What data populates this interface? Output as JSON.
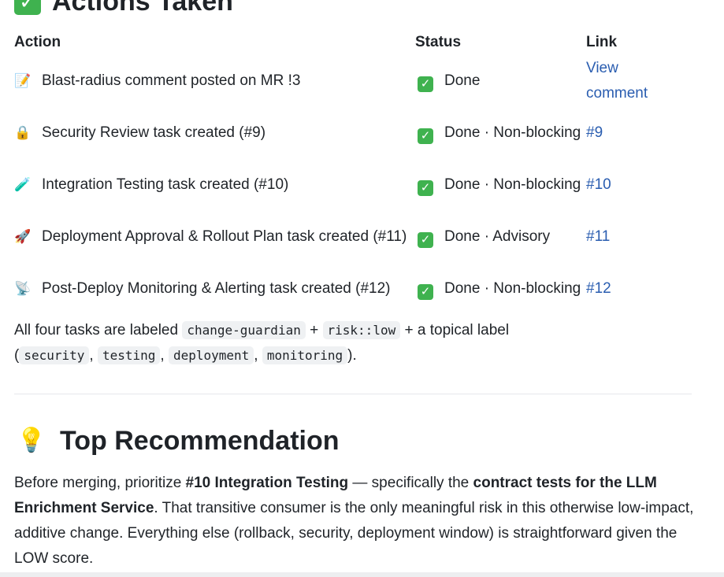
{
  "actions_section": {
    "title": "Actions Taken",
    "headers": {
      "action": "Action",
      "status": "Status",
      "link": "Link"
    },
    "rows": [
      {
        "icon": "memo-icon",
        "emoji": "📝",
        "action": "Blast-radius comment posted on MR !3",
        "status": "Done",
        "link": "View comment"
      },
      {
        "icon": "lock-icon",
        "emoji": "🔒",
        "action": "Security Review task created (#9)",
        "status": "Done · Non-blocking",
        "link": "#9"
      },
      {
        "icon": "test-tube-icon",
        "emoji": "🧪",
        "action": "Integration Testing task created (#10)",
        "status": "Done · Non-blocking",
        "link": "#10"
      },
      {
        "icon": "rocket-icon",
        "emoji": "🚀",
        "action": "Deployment Approval & Rollout Plan task created (#11)",
        "status": "Done · Advisory",
        "link": "#11"
      },
      {
        "icon": "satellite-icon",
        "emoji": "📡",
        "action": "Post-Deploy Monitoring & Alerting task created (#12)",
        "status": "Done · Non-blocking",
        "link": "#12"
      }
    ],
    "note": {
      "prefix": "All four tasks are labeled",
      "label1": "change-guardian",
      "plus1": "+",
      "label2": "risk::low",
      "mid": "+ a topical label",
      "open_paren": "(",
      "topic1": "security",
      "topic2": "testing",
      "topic3": "deployment",
      "topic4": "monitoring",
      "close": ")."
    }
  },
  "recommendation": {
    "title": "Top Recommendation",
    "part1": "Before merging, prioritize",
    "bold1": "#10 Integration Testing",
    "part2": "— specifically the",
    "bold2": "contract tests for the LLM Enrichment Service",
    "part3": ". That transitive consumer is the only meaningful risk in this otherwise low-impact, additive change. Everything else (rollback, security, deployment window) is straightforward given the LOW score."
  },
  "colors": {
    "check_green": "#3fb24f",
    "link_blue": "#2a5db0",
    "bulb_yellow": "#f2b01e"
  }
}
